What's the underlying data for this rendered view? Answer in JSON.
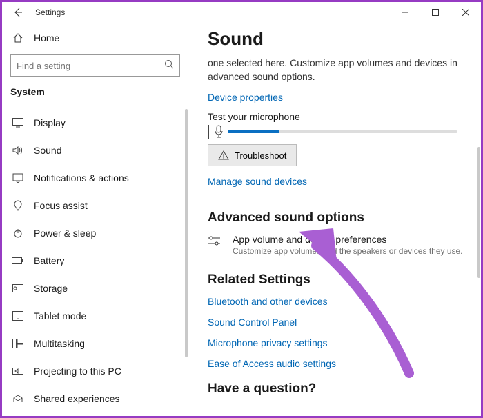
{
  "window": {
    "title": "Settings"
  },
  "sidebar": {
    "home": "Home",
    "search_placeholder": "Find a setting",
    "category": "System",
    "items": [
      {
        "label": "Display"
      },
      {
        "label": "Sound"
      },
      {
        "label": "Notifications & actions"
      },
      {
        "label": "Focus assist"
      },
      {
        "label": "Power & sleep"
      },
      {
        "label": "Battery"
      },
      {
        "label": "Storage"
      },
      {
        "label": "Tablet mode"
      },
      {
        "label": "Multitasking"
      },
      {
        "label": "Projecting to this PC"
      },
      {
        "label": "Shared experiences"
      }
    ]
  },
  "main": {
    "title": "Sound",
    "desc": "one selected here. Customize app volumes and devices in advanced sound options.",
    "device_props": "Device properties",
    "test_label": "Test your microphone",
    "troubleshoot": "Troubleshoot",
    "manage": "Manage sound devices",
    "adv_title": "Advanced sound options",
    "adv_item_title": "App volume and device preferences",
    "adv_item_sub": "Customize app volumes and the speakers or devices they use.",
    "related_title": "Related Settings",
    "related_links": [
      "Bluetooth and other devices",
      "Sound Control Panel",
      "Microphone privacy settings",
      "Ease of Access audio settings"
    ],
    "question": "Have a question?"
  }
}
